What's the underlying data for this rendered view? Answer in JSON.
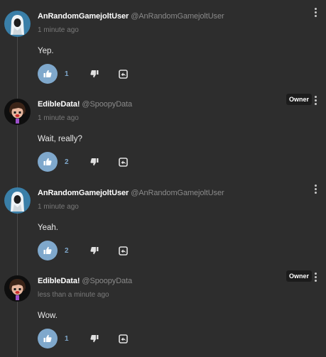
{
  "colors": {
    "background": "#2d2d2d",
    "like_active": "#7fa8cc",
    "badge_bg": "#1c1c1c"
  },
  "comments": [
    {
      "username": "AnRandomGamejoltUser",
      "handle": "@AnRandomGamejoltUser",
      "time": "1 minute ago",
      "text": "Yep.",
      "likes": "1",
      "owner_badge": ""
    },
    {
      "username": "EdibleData!",
      "handle": "@SpoopyData",
      "time": "1 minute ago",
      "text": "Wait, really?",
      "likes": "2",
      "owner_badge": "Owner"
    },
    {
      "username": "AnRandomGamejoltUser",
      "handle": "@AnRandomGamejoltUser",
      "time": "1 minute ago",
      "text": "Yeah.",
      "likes": "2",
      "owner_badge": ""
    },
    {
      "username": "EdibleData!",
      "handle": "@SpoopyData",
      "time": "less than a minute ago",
      "text": "Wow.",
      "likes": "1",
      "owner_badge": "Owner"
    }
  ],
  "icons": {
    "like": "thumbs-up-icon",
    "dislike": "thumbs-down-icon",
    "reply": "reply-icon",
    "more": "more-vertical-icon"
  }
}
